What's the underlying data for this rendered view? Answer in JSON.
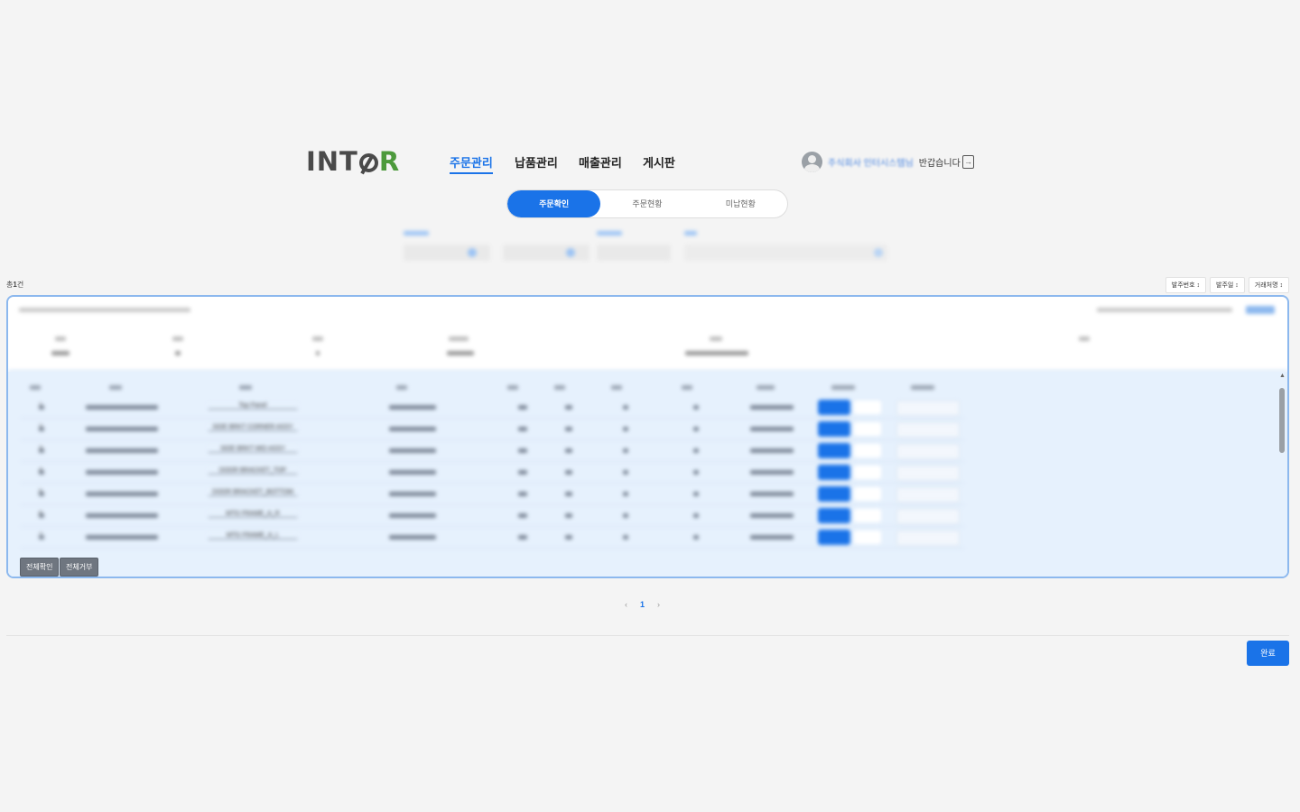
{
  "header": {
    "logo_left": "INT",
    "logo_right": "R",
    "nav": [
      "주문관리",
      "납품관리",
      "매출관리",
      "게시판"
    ],
    "user_company": "주식회사 인터시스템님",
    "greeting": "반갑습니다"
  },
  "tabs": [
    "주문확인",
    "주문현황",
    "미납현황"
  ],
  "list": {
    "total_prefix": "총",
    "total_count": "1",
    "total_suffix": "건",
    "sort_buttons": [
      "발주번호 ↕",
      "발주일 ↕",
      "거래처명 ↕"
    ]
  },
  "rows": [
    {
      "no": "1",
      "part_name": "Top Panel"
    },
    {
      "no": "2",
      "part_name": "SIDE BRKT CORNER ASSY"
    },
    {
      "no": "3",
      "part_name": "SIDE BRKT MID ASSY"
    },
    {
      "no": "4",
      "part_name": "DOOR BRACKET_TOP"
    },
    {
      "no": "5",
      "part_name": "DOOR BRACKET_BOTTOM"
    },
    {
      "no": "6",
      "part_name": "MTG FRAME_A_R"
    },
    {
      "no": "7",
      "part_name": "MTG FRAME_A_L"
    }
  ],
  "bulk_actions": {
    "confirm_all": "전체확인",
    "reject_all": "전체거부"
  },
  "pagination": {
    "prev": "‹",
    "current": "1",
    "next": "›"
  },
  "footer": {
    "done_label": "완료"
  },
  "colors": {
    "accent": "#1a73e8",
    "logo_green": "#4d9a3c",
    "card_border": "#8cb8ee",
    "table_bg": "#e6f1fd"
  }
}
